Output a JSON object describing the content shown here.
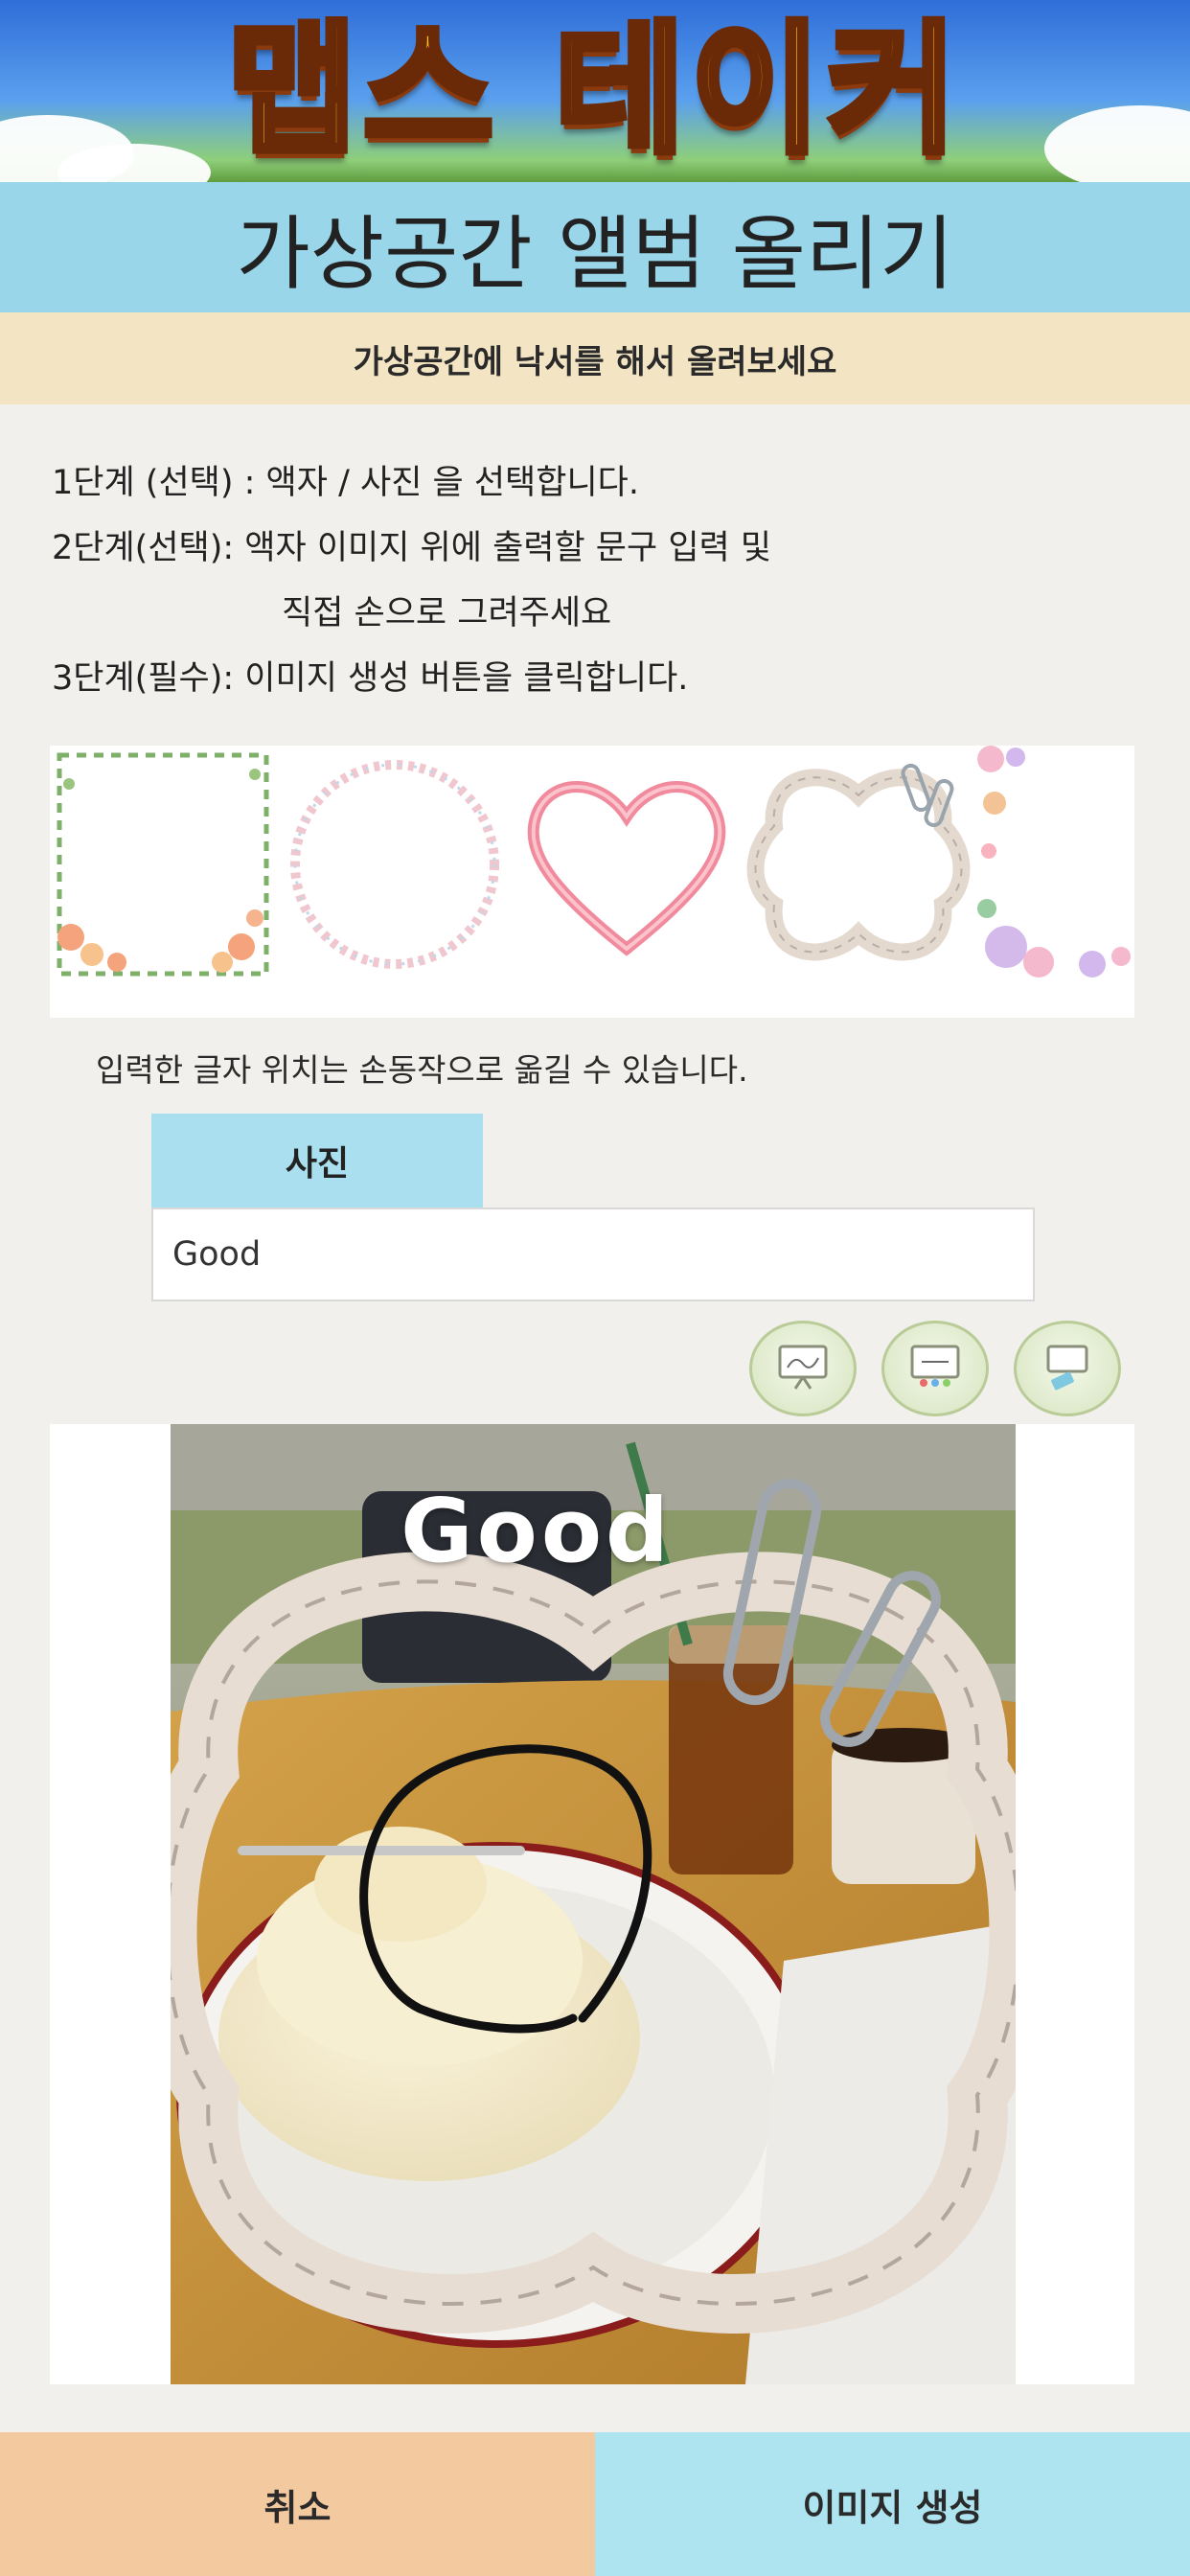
{
  "app": {
    "banner_title": "맵스 테이커"
  },
  "header": {
    "title": "가상공간 앨범 올리기",
    "notice": "가상공간에 낙서를 해서 올려보세요"
  },
  "steps": {
    "step1": "1단계 (선택) : 액자 / 사진 을 선택합니다.",
    "step2": "2단계(선택):  액자 이미지 위에 출력할 문구 입력 및",
    "step2_cont": "직접 손으로 그려주세요",
    "step3": "3단계(필수): 이미지 생성 버튼을 클릭합니다."
  },
  "frames": [
    {
      "name": "flower-vine-frame"
    },
    {
      "name": "dotted-circle-frame"
    },
    {
      "name": "pink-heart-frame"
    },
    {
      "name": "clover-paperclip-frame"
    },
    {
      "name": "watercolor-floral-frame"
    }
  ],
  "hint": "입력한 글자 위치는 손동작으로 옮길 수 있습니다.",
  "tab": {
    "label": "사진"
  },
  "text_input": {
    "value": "Good"
  },
  "tools": [
    {
      "icon": "easel-draw-icon"
    },
    {
      "icon": "palette-board-icon"
    },
    {
      "icon": "eraser-board-icon"
    }
  ],
  "canvas": {
    "overlay_text": "Good"
  },
  "buttons": {
    "cancel": "취소",
    "generate": "이미지 생성"
  }
}
